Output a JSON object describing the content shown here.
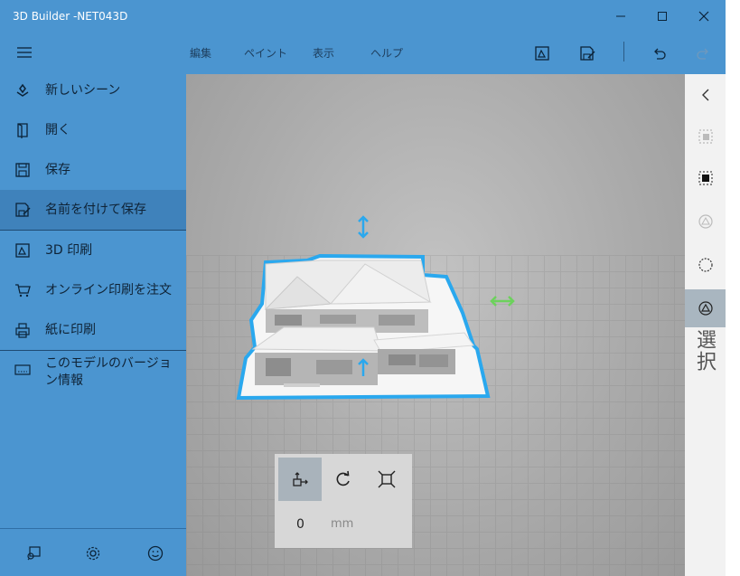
{
  "window": {
    "title": "3D Builder -NET043D",
    "controls": {
      "minimize": "minimize-icon",
      "maximize": "maximize-icon",
      "close": "close-icon"
    }
  },
  "toolbar": {
    "tabs": [
      "編集",
      "ペイント",
      "表示",
      "ヘルプ"
    ],
    "icons": [
      "3d-print-icon",
      "save-as-icon",
      "undo-icon",
      "redo-icon"
    ]
  },
  "nav": {
    "items": [
      {
        "label": "新しいシーン",
        "icon": "new-scene-icon"
      },
      {
        "label": "開く",
        "icon": "open-icon"
      },
      {
        "label": "保存",
        "icon": "save-icon"
      },
      {
        "label": "名前を付けて保存",
        "icon": "save-as-icon",
        "selected": true
      },
      {
        "label": "3D 印刷",
        "icon": "3d-print-icon"
      },
      {
        "label": "オンライン印刷を注文",
        "icon": "cart-icon"
      },
      {
        "label": "紙に印刷",
        "icon": "printer-icon"
      },
      {
        "label": "このモデルのバージョン情報",
        "icon": "model-info-icon"
      }
    ],
    "bottom_icons": [
      "feedback-icon",
      "settings-icon",
      "smiley-icon"
    ]
  },
  "right_rail": {
    "label": "選択",
    "icons": [
      "collapse-icon",
      "select-object-icon",
      "select-face-icon",
      "select-vertex-icon",
      "lasso-icon",
      "select-mode-icon"
    ]
  },
  "transform_panel": {
    "tools": [
      "move-icon",
      "rotate-icon",
      "scale-icon"
    ],
    "value": "0",
    "unit": "mm"
  },
  "colors": {
    "accent": "#4b95d0",
    "selection": "#2aa8ee",
    "arrow_green": "#6cd25c"
  }
}
